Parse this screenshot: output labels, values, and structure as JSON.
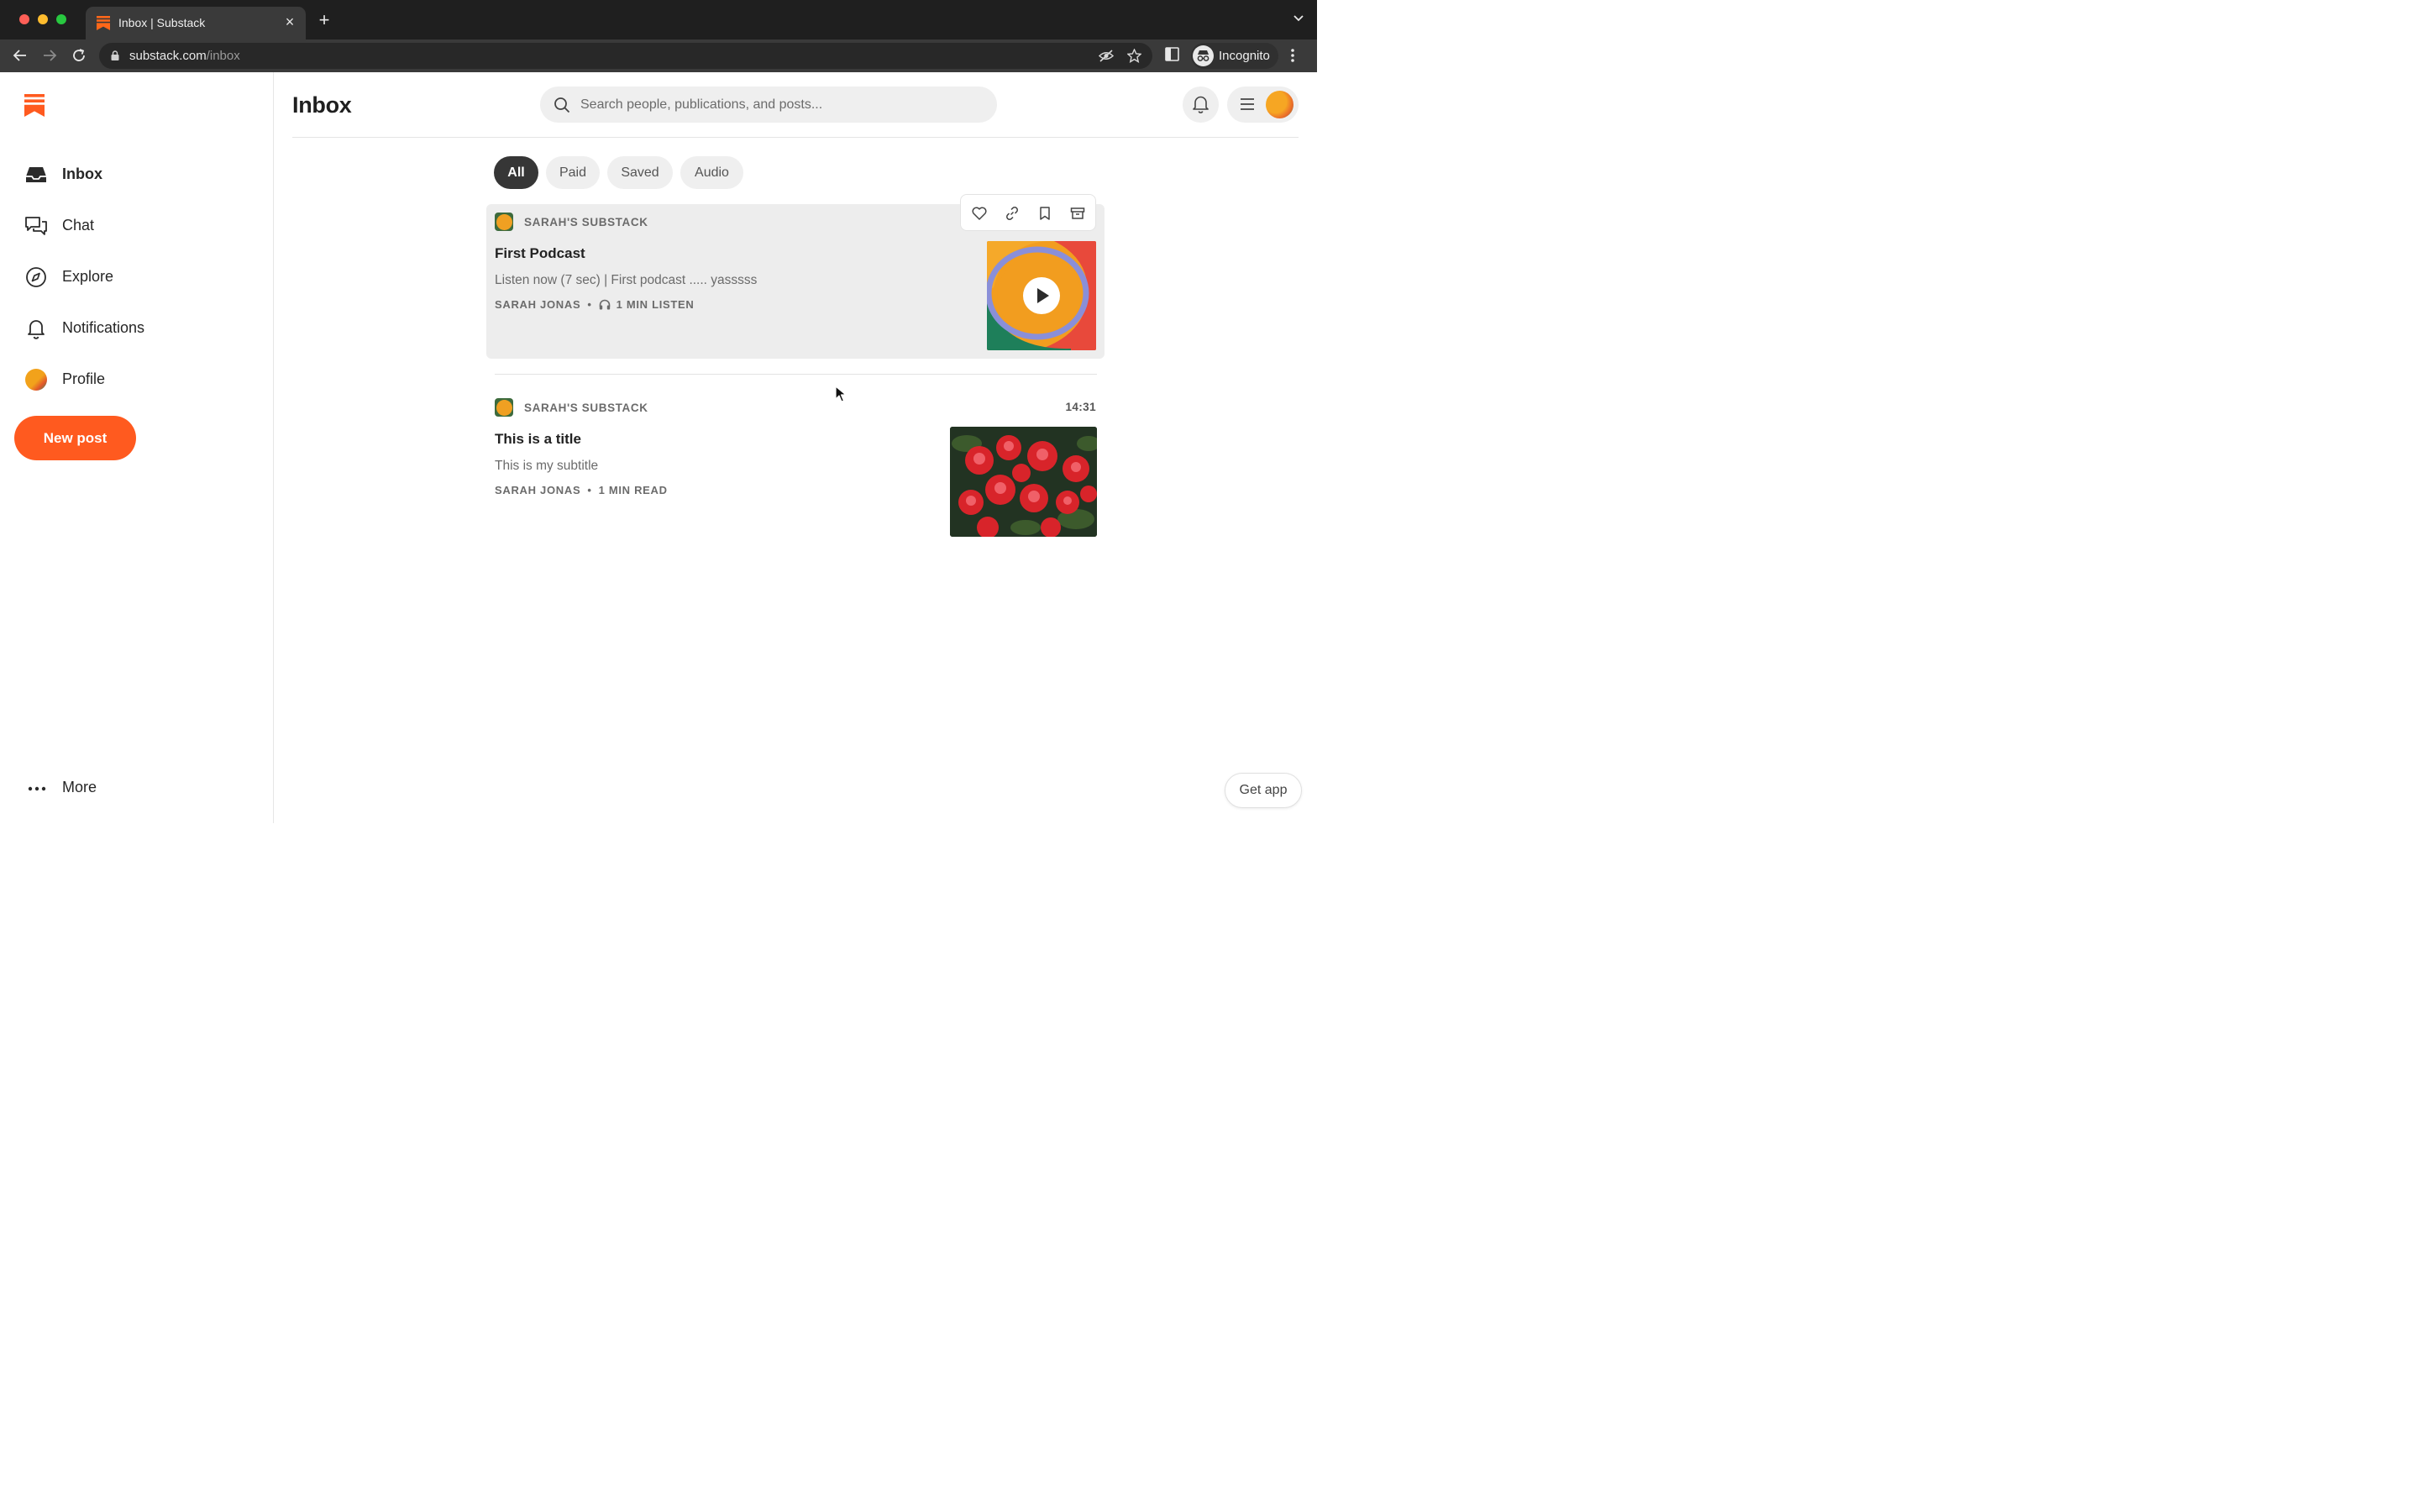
{
  "browser": {
    "tab_title": "Inbox | Substack",
    "url_host": "substack.com",
    "url_path": "/inbox",
    "profile_label": "Incognito"
  },
  "sidebar": {
    "items": [
      {
        "label": "Inbox",
        "icon": "inbox-icon"
      },
      {
        "label": "Chat",
        "icon": "chat-icon"
      },
      {
        "label": "Explore",
        "icon": "compass-icon"
      },
      {
        "label": "Notifications",
        "icon": "bell-icon"
      },
      {
        "label": "Profile",
        "icon": "avatar"
      }
    ],
    "new_post_label": "New post",
    "more_label": "More"
  },
  "header": {
    "title": "Inbox",
    "search_placeholder": "Search people, publications, and posts..."
  },
  "filters": [
    "All",
    "Paid",
    "Saved",
    "Audio"
  ],
  "active_filter": "All",
  "posts": [
    {
      "publication": "SARAH'S SUBSTACK",
      "title": "First Podcast",
      "subtitle": "Listen now (7 sec) | First podcast ..... yasssss",
      "author": "SARAH JONAS",
      "meta_icon": "headphones-icon",
      "duration": "1 MIN LISTEN"
    },
    {
      "publication": "SARAH'S SUBSTACK",
      "time": "14:31",
      "title": "This is a title",
      "subtitle": "This is my subtitle",
      "author": "SARAH JONAS",
      "duration": "1 MIN READ"
    }
  ],
  "get_app_label": "Get app",
  "colors": {
    "accent": "#ff5a1f",
    "active_chip": "#363636",
    "chrome_dark": "#1f1f1f"
  }
}
